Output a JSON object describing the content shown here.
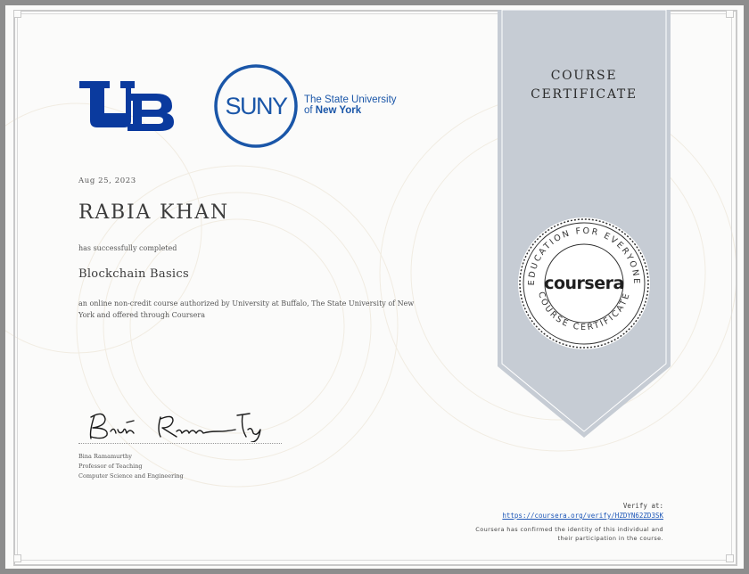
{
  "logos": {
    "suny_mark": "SUNY",
    "suny_line1": "The State University",
    "suny_line2_prefix": "of ",
    "suny_line2_bold": "New York"
  },
  "certificate": {
    "date": "Aug 25, 2023",
    "recipient": "RABIA KHAN",
    "completed_text": "has successfully completed",
    "course_name": "Blockchain Basics",
    "description": "an online non-credit course authorized by University at Buffalo, The State University of New York and offered through Coursera"
  },
  "signer": {
    "name": "Bina Ramamurthy",
    "title": "Professor of Teaching",
    "department": "Computer Science and Engineering"
  },
  "ribbon": {
    "line1": "COURSE",
    "line2": "CERTIFICATE"
  },
  "seal": {
    "top_text": "EDUCATION FOR EVERYONE",
    "brand": "coursera",
    "bottom_text": "COURSE CERTIFICATE"
  },
  "verification": {
    "label": "Verify at:",
    "url": "https://coursera.org/verify/HZDYN62ZD3SK",
    "confirm_line1": "Coursera has confirmed the identity of this individual and",
    "confirm_line2": "their participation in the course."
  },
  "colors": {
    "ub_blue": "#0a3a9e",
    "suny_blue": "#1a56a8",
    "ribbon": "#c6ccd4",
    "link": "#1d57b8"
  }
}
